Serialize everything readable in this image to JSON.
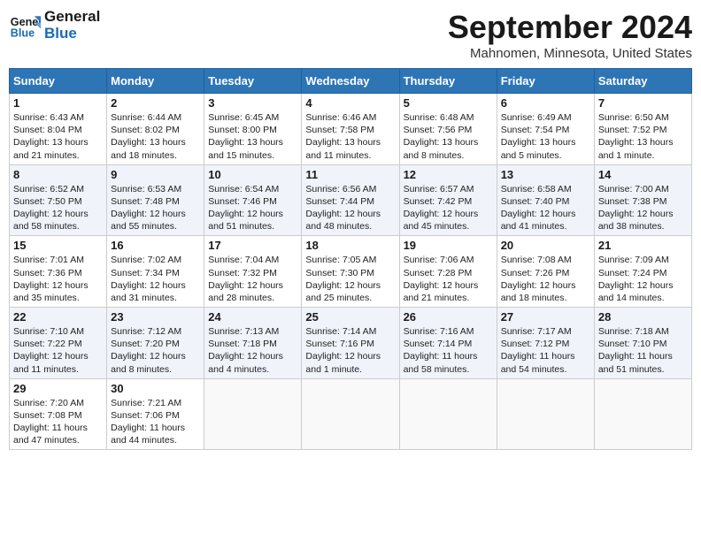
{
  "header": {
    "logo_line1": "General",
    "logo_line2": "Blue",
    "month_title": "September 2024",
    "location": "Mahnomen, Minnesota, United States"
  },
  "days_of_week": [
    "Sunday",
    "Monday",
    "Tuesday",
    "Wednesday",
    "Thursday",
    "Friday",
    "Saturday"
  ],
  "weeks": [
    [
      {
        "num": "1",
        "info": "Sunrise: 6:43 AM\nSunset: 8:04 PM\nDaylight: 13 hours\nand 21 minutes."
      },
      {
        "num": "2",
        "info": "Sunrise: 6:44 AM\nSunset: 8:02 PM\nDaylight: 13 hours\nand 18 minutes."
      },
      {
        "num": "3",
        "info": "Sunrise: 6:45 AM\nSunset: 8:00 PM\nDaylight: 13 hours\nand 15 minutes."
      },
      {
        "num": "4",
        "info": "Sunrise: 6:46 AM\nSunset: 7:58 PM\nDaylight: 13 hours\nand 11 minutes."
      },
      {
        "num": "5",
        "info": "Sunrise: 6:48 AM\nSunset: 7:56 PM\nDaylight: 13 hours\nand 8 minutes."
      },
      {
        "num": "6",
        "info": "Sunrise: 6:49 AM\nSunset: 7:54 PM\nDaylight: 13 hours\nand 5 minutes."
      },
      {
        "num": "7",
        "info": "Sunrise: 6:50 AM\nSunset: 7:52 PM\nDaylight: 13 hours\nand 1 minute."
      }
    ],
    [
      {
        "num": "8",
        "info": "Sunrise: 6:52 AM\nSunset: 7:50 PM\nDaylight: 12 hours\nand 58 minutes."
      },
      {
        "num": "9",
        "info": "Sunrise: 6:53 AM\nSunset: 7:48 PM\nDaylight: 12 hours\nand 55 minutes."
      },
      {
        "num": "10",
        "info": "Sunrise: 6:54 AM\nSunset: 7:46 PM\nDaylight: 12 hours\nand 51 minutes."
      },
      {
        "num": "11",
        "info": "Sunrise: 6:56 AM\nSunset: 7:44 PM\nDaylight: 12 hours\nand 48 minutes."
      },
      {
        "num": "12",
        "info": "Sunrise: 6:57 AM\nSunset: 7:42 PM\nDaylight: 12 hours\nand 45 minutes."
      },
      {
        "num": "13",
        "info": "Sunrise: 6:58 AM\nSunset: 7:40 PM\nDaylight: 12 hours\nand 41 minutes."
      },
      {
        "num": "14",
        "info": "Sunrise: 7:00 AM\nSunset: 7:38 PM\nDaylight: 12 hours\nand 38 minutes."
      }
    ],
    [
      {
        "num": "15",
        "info": "Sunrise: 7:01 AM\nSunset: 7:36 PM\nDaylight: 12 hours\nand 35 minutes."
      },
      {
        "num": "16",
        "info": "Sunrise: 7:02 AM\nSunset: 7:34 PM\nDaylight: 12 hours\nand 31 minutes."
      },
      {
        "num": "17",
        "info": "Sunrise: 7:04 AM\nSunset: 7:32 PM\nDaylight: 12 hours\nand 28 minutes."
      },
      {
        "num": "18",
        "info": "Sunrise: 7:05 AM\nSunset: 7:30 PM\nDaylight: 12 hours\nand 25 minutes."
      },
      {
        "num": "19",
        "info": "Sunrise: 7:06 AM\nSunset: 7:28 PM\nDaylight: 12 hours\nand 21 minutes."
      },
      {
        "num": "20",
        "info": "Sunrise: 7:08 AM\nSunset: 7:26 PM\nDaylight: 12 hours\nand 18 minutes."
      },
      {
        "num": "21",
        "info": "Sunrise: 7:09 AM\nSunset: 7:24 PM\nDaylight: 12 hours\nand 14 minutes."
      }
    ],
    [
      {
        "num": "22",
        "info": "Sunrise: 7:10 AM\nSunset: 7:22 PM\nDaylight: 12 hours\nand 11 minutes."
      },
      {
        "num": "23",
        "info": "Sunrise: 7:12 AM\nSunset: 7:20 PM\nDaylight: 12 hours\nand 8 minutes."
      },
      {
        "num": "24",
        "info": "Sunrise: 7:13 AM\nSunset: 7:18 PM\nDaylight: 12 hours\nand 4 minutes."
      },
      {
        "num": "25",
        "info": "Sunrise: 7:14 AM\nSunset: 7:16 PM\nDaylight: 12 hours\nand 1 minute."
      },
      {
        "num": "26",
        "info": "Sunrise: 7:16 AM\nSunset: 7:14 PM\nDaylight: 11 hours\nand 58 minutes."
      },
      {
        "num": "27",
        "info": "Sunrise: 7:17 AM\nSunset: 7:12 PM\nDaylight: 11 hours\nand 54 minutes."
      },
      {
        "num": "28",
        "info": "Sunrise: 7:18 AM\nSunset: 7:10 PM\nDaylight: 11 hours\nand 51 minutes."
      }
    ],
    [
      {
        "num": "29",
        "info": "Sunrise: 7:20 AM\nSunset: 7:08 PM\nDaylight: 11 hours\nand 47 minutes."
      },
      {
        "num": "30",
        "info": "Sunrise: 7:21 AM\nSunset: 7:06 PM\nDaylight: 11 hours\nand 44 minutes."
      },
      null,
      null,
      null,
      null,
      null
    ]
  ]
}
